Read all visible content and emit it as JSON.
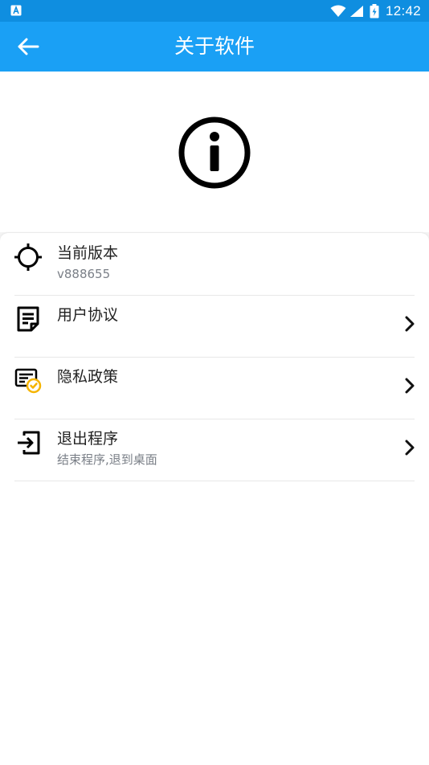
{
  "status_bar": {
    "time": "12:42",
    "left_icon": "app-notification-icon",
    "icons": [
      "wifi-icon",
      "signal-icon",
      "battery-icon"
    ]
  },
  "app_bar": {
    "title": "关于软件",
    "back_icon": "arrow-left-icon"
  },
  "hero": {
    "icon": "info-circle-icon"
  },
  "list": [
    {
      "title": "当前版本",
      "subtitle": "v888655",
      "icon": "crosshair-icon",
      "has_chevron": false
    },
    {
      "title": "用户协议",
      "subtitle": "",
      "icon": "document-icon",
      "has_chevron": true
    },
    {
      "title": "隐私政策",
      "subtitle": "",
      "icon": "privacy-certificate-icon",
      "has_chevron": true
    },
    {
      "title": "退出程序",
      "subtitle": "结束程序,退到桌面",
      "icon": "exit-icon",
      "has_chevron": true
    }
  ],
  "colors": {
    "status_bar": "#0f8ee0",
    "app_bar": "#1aa0f5",
    "background": "#f3f3f3",
    "card": "#ffffff",
    "accent_badge": "#f5b400"
  }
}
